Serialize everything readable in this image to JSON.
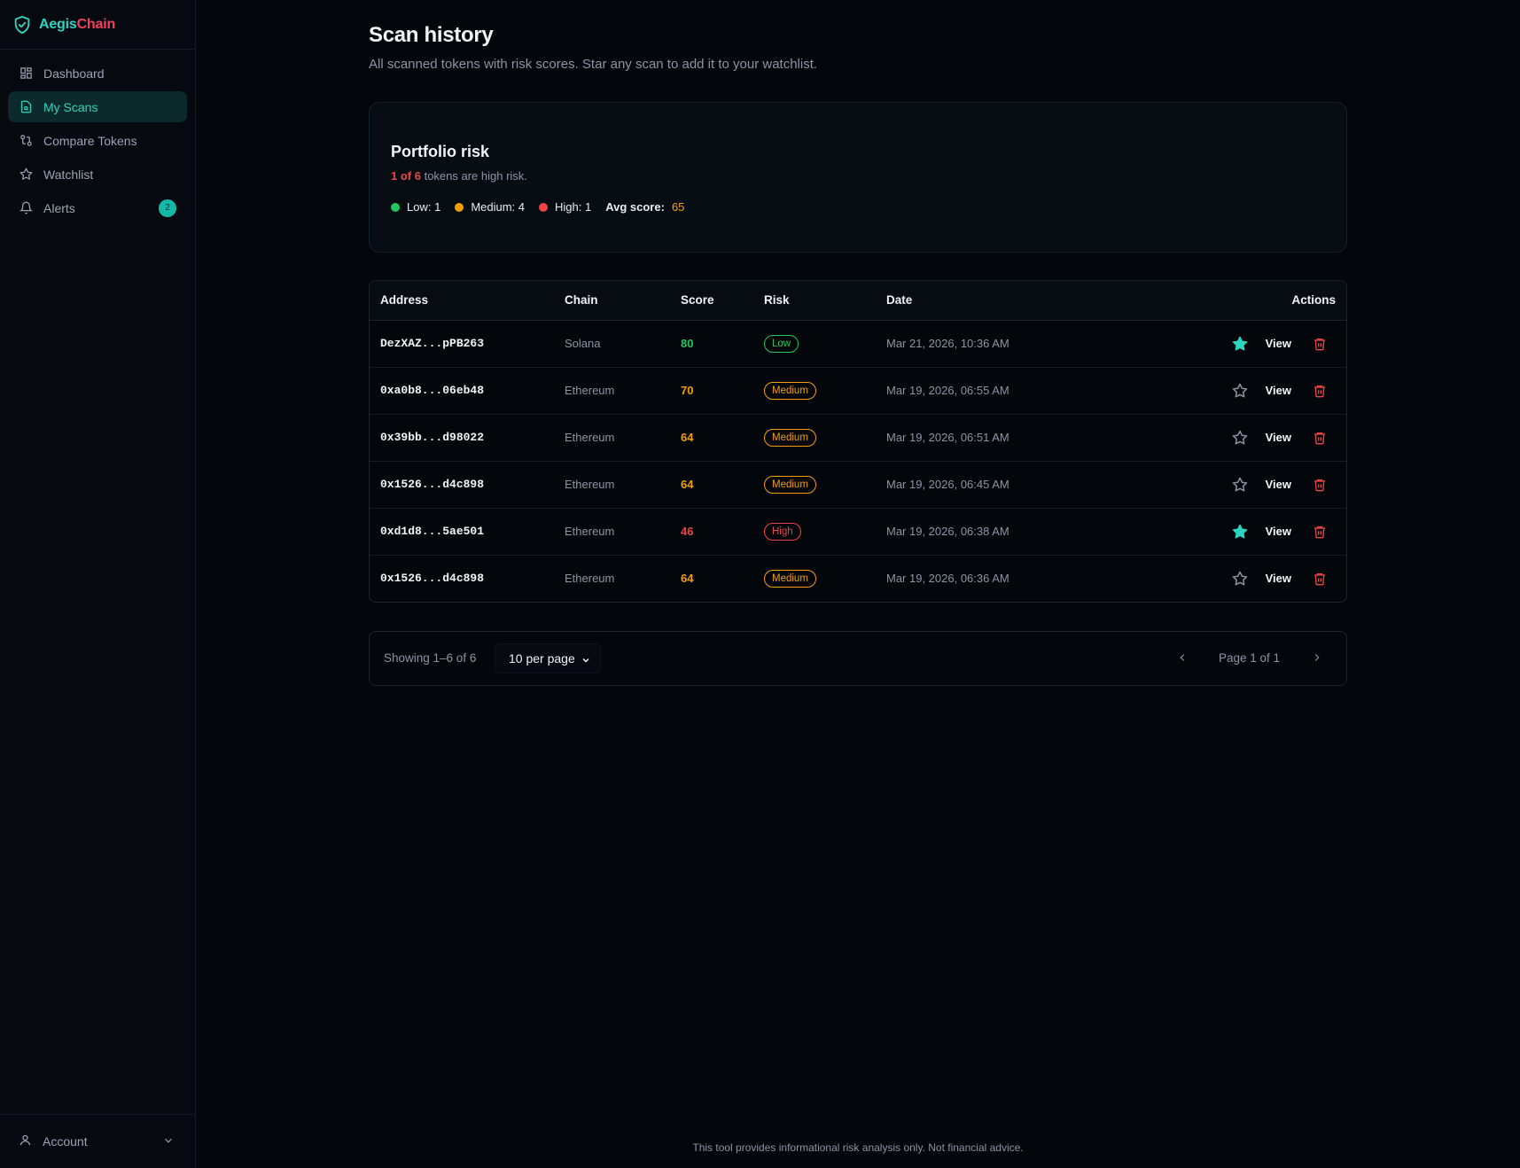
{
  "brand": {
    "part1": "Aegis",
    "part2": "Chain"
  },
  "sidebar": {
    "items": [
      {
        "label": "Dashboard"
      },
      {
        "label": "My Scans"
      },
      {
        "label": "Compare Tokens"
      },
      {
        "label": "Watchlist"
      },
      {
        "label": "Alerts",
        "badge": "2"
      }
    ],
    "account": "Account"
  },
  "page": {
    "title": "Scan history",
    "subtitle": "All scanned tokens with risk scores. Star any scan to add it to your watchlist."
  },
  "portfolio": {
    "title": "Portfolio risk",
    "highlight": "1 of 6",
    "summary_rest": " tokens are high risk.",
    "low": "Low: 1",
    "medium": "Medium: 4",
    "high": "High: 1",
    "avg_label": "Avg score:",
    "avg_value": "65"
  },
  "table": {
    "headers": {
      "address": "Address",
      "chain": "Chain",
      "score": "Score",
      "risk": "Risk",
      "date": "Date",
      "actions": "Actions"
    },
    "view_label": "View",
    "rows": [
      {
        "address": "DezXAZ...pPB263",
        "chain": "Solana",
        "score": "80",
        "risk": "Low",
        "date": "Mar 21, 2026, 10:36 AM",
        "starred": true
      },
      {
        "address": "0xa0b8...06eb48",
        "chain": "Ethereum",
        "score": "70",
        "risk": "Medium",
        "date": "Mar 19, 2026, 06:55 AM",
        "starred": false
      },
      {
        "address": "0x39bb...d98022",
        "chain": "Ethereum",
        "score": "64",
        "risk": "Medium",
        "date": "Mar 19, 2026, 06:51 AM",
        "starred": false
      },
      {
        "address": "0x1526...d4c898",
        "chain": "Ethereum",
        "score": "64",
        "risk": "Medium",
        "date": "Mar 19, 2026, 06:45 AM",
        "starred": false
      },
      {
        "address": "0xd1d8...5ae501",
        "chain": "Ethereum",
        "score": "46",
        "risk": "High",
        "date": "Mar 19, 2026, 06:38 AM",
        "starred": true
      },
      {
        "address": "0x1526...d4c898",
        "chain": "Ethereum",
        "score": "64",
        "risk": "Medium",
        "date": "Mar 19, 2026, 06:36 AM",
        "starred": false
      }
    ]
  },
  "pagination": {
    "showing": "Showing 1–6 of 6",
    "per_page": "10 per page",
    "page_info": "Page 1 of 1"
  },
  "footer": "This tool provides informational risk analysis only. Not financial advice.",
  "colors": {
    "accent": "#2dd4bf",
    "low": "#22c55e",
    "medium": "#f59e0b",
    "high": "#ef4444"
  }
}
